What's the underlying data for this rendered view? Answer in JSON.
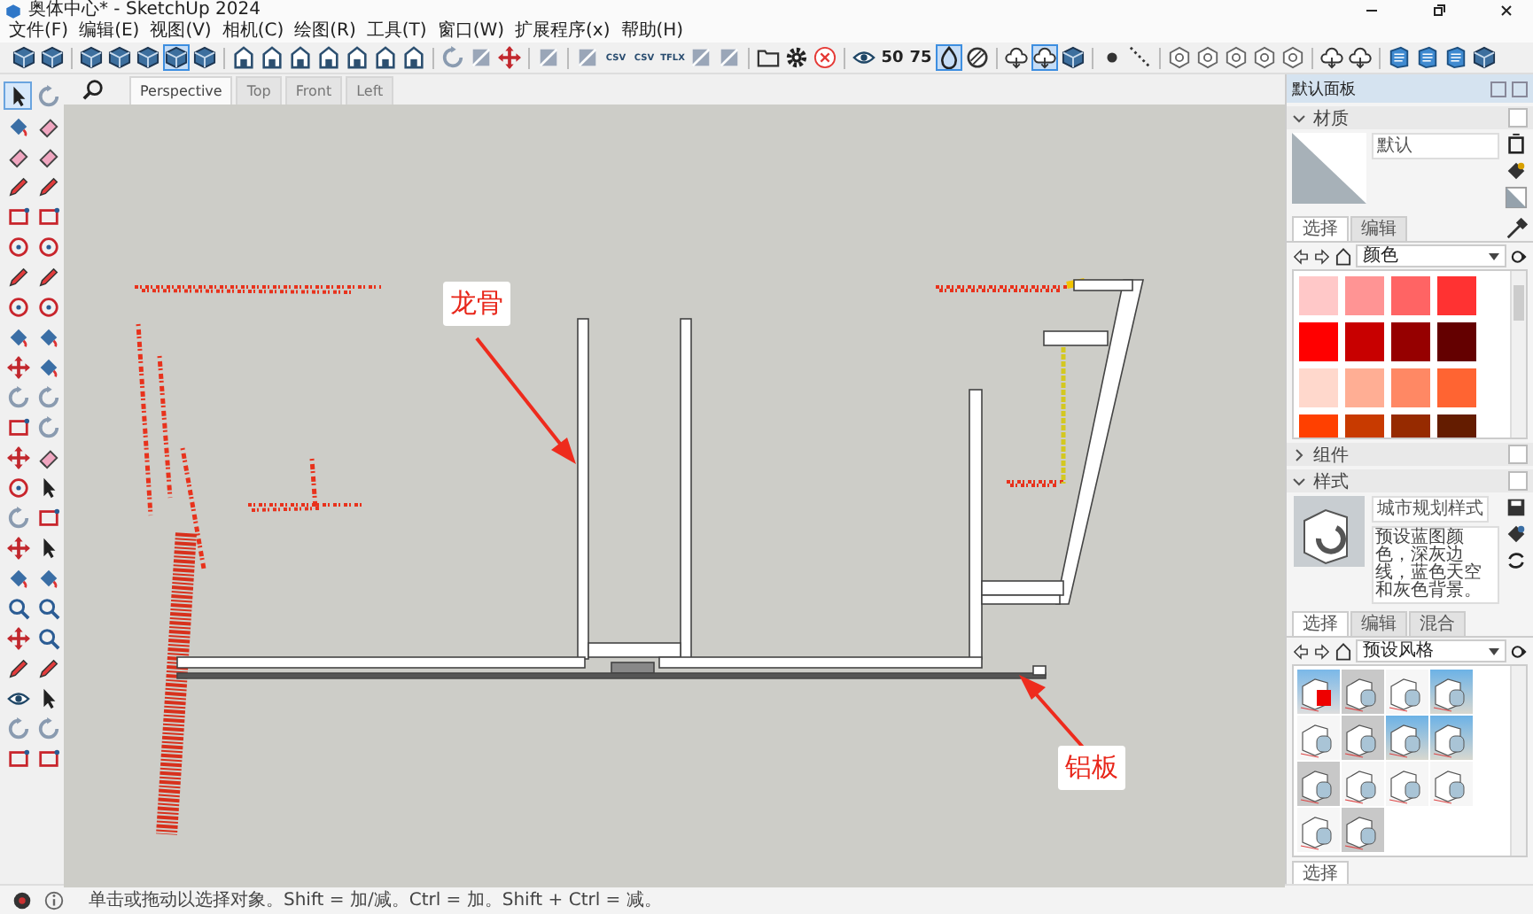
{
  "window": {
    "title": "奥体中心* - SketchUp 2024"
  },
  "menu": [
    "文件(F)",
    "编辑(E)",
    "视图(V)",
    "相机(C)",
    "绘图(R)",
    "工具(T)",
    "窗口(W)",
    "扩展程序(x)",
    "帮助(H)"
  ],
  "toolbar": [
    {
      "kind": "cube",
      "selected": false
    },
    {
      "kind": "cube",
      "selected": false
    },
    {
      "kind": "sep"
    },
    {
      "kind": "cube",
      "selected": false
    },
    {
      "kind": "cube",
      "selected": false
    },
    {
      "kind": "cube",
      "selected": false
    },
    {
      "kind": "cube",
      "selected": true
    },
    {
      "kind": "cube",
      "selected": false
    },
    {
      "kind": "sep"
    },
    {
      "kind": "view",
      "selected": false
    },
    {
      "kind": "view",
      "selected": false
    },
    {
      "kind": "view",
      "selected": false
    },
    {
      "kind": "view",
      "selected": false
    },
    {
      "kind": "view",
      "selected": false
    },
    {
      "kind": "view",
      "selected": false
    },
    {
      "kind": "view",
      "selected": false
    },
    {
      "kind": "sep"
    },
    {
      "kind": "orbit",
      "selected": false
    },
    {
      "kind": "section",
      "selected": false
    },
    {
      "kind": "move",
      "selected": false
    },
    {
      "kind": "sep"
    },
    {
      "kind": "section",
      "selected": false
    },
    {
      "kind": "sep"
    },
    {
      "kind": "section",
      "selected": false
    },
    {
      "kind": "csv",
      "label": "CSV",
      "selected": false
    },
    {
      "kind": "csv",
      "label": "CSV",
      "selected": false
    },
    {
      "kind": "csv",
      "label": "TFLX",
      "selected": false
    },
    {
      "kind": "section",
      "selected": false
    },
    {
      "kind": "section",
      "selected": false
    },
    {
      "kind": "sep"
    },
    {
      "kind": "folder",
      "selected": false
    },
    {
      "kind": "gear",
      "selected": false
    },
    {
      "kind": "close",
      "selected": false
    },
    {
      "kind": "sep"
    },
    {
      "kind": "eye",
      "selected": false
    },
    {
      "kind": "cloud-num",
      "label": "50",
      "selected": false
    },
    {
      "kind": "cloud-num",
      "label": "75",
      "selected": false
    },
    {
      "kind": "drop",
      "selected": true
    },
    {
      "kind": "ball",
      "selected": false
    },
    {
      "kind": "sep"
    },
    {
      "kind": "cloud",
      "selected": false
    },
    {
      "kind": "cloud",
      "selected": true
    },
    {
      "kind": "cube",
      "selected": false
    },
    {
      "kind": "sep"
    },
    {
      "kind": "dot",
      "selected": false
    },
    {
      "kind": "dots",
      "selected": false
    },
    {
      "kind": "sep"
    },
    {
      "kind": "hex",
      "selected": false
    },
    {
      "kind": "hex",
      "selected": false
    },
    {
      "kind": "hex",
      "selected": false
    },
    {
      "kind": "hex",
      "selected": false
    },
    {
      "kind": "hex",
      "selected": false
    },
    {
      "kind": "sep"
    },
    {
      "kind": "cloud",
      "selected": false
    },
    {
      "kind": "cloud",
      "selected": false
    },
    {
      "kind": "sep"
    },
    {
      "kind": "book",
      "selected": false
    },
    {
      "kind": "book",
      "selected": false
    },
    {
      "kind": "book",
      "selected": false
    },
    {
      "kind": "cube",
      "selected": false
    }
  ],
  "left_tools": [
    {
      "kind": "arrow",
      "selected": true
    },
    {
      "kind": "orbit",
      "selected": false
    },
    {
      "kind": "paint",
      "selected": false
    },
    {
      "kind": "eraser",
      "selected": false
    },
    {
      "kind": "eraser",
      "selected": false
    },
    {
      "kind": "eraser",
      "selected": false
    },
    {
      "kind": "pencil",
      "selected": false
    },
    {
      "kind": "pencil",
      "selected": false
    },
    {
      "kind": "rect",
      "selected": false
    },
    {
      "kind": "rect",
      "selected": false
    },
    {
      "kind": "circle",
      "selected": false
    },
    {
      "kind": "circle",
      "selected": false
    },
    {
      "kind": "pencil",
      "selected": false
    },
    {
      "kind": "pencil",
      "selected": false
    },
    {
      "kind": "circle",
      "selected": false
    },
    {
      "kind": "circle",
      "selected": false
    },
    {
      "kind": "paint",
      "selected": false
    },
    {
      "kind": "paint",
      "selected": false
    },
    {
      "kind": "move",
      "selected": false
    },
    {
      "kind": "paint",
      "selected": false
    },
    {
      "kind": "orbit",
      "selected": false
    },
    {
      "kind": "orbit",
      "selected": false
    },
    {
      "kind": "rect",
      "selected": false
    },
    {
      "kind": "orbit",
      "selected": false
    },
    {
      "kind": "move",
      "selected": false
    },
    {
      "kind": "eraser",
      "selected": false
    },
    {
      "kind": "circle",
      "selected": false
    },
    {
      "kind": "arrow",
      "selected": false
    },
    {
      "kind": "orbit",
      "selected": false
    },
    {
      "kind": "rect",
      "selected": false
    },
    {
      "kind": "move",
      "selected": false
    },
    {
      "kind": "arrow",
      "selected": false
    },
    {
      "kind": "paint",
      "selected": false
    },
    {
      "kind": "paint",
      "selected": false
    },
    {
      "kind": "zoom",
      "selected": false
    },
    {
      "kind": "zoom",
      "selected": false
    },
    {
      "kind": "move",
      "selected": false
    },
    {
      "kind": "zoom",
      "selected": false
    },
    {
      "kind": "pencil",
      "selected": false
    },
    {
      "kind": "pencil",
      "selected": false
    },
    {
      "kind": "eye",
      "selected": false
    },
    {
      "kind": "arrow",
      "selected": false
    },
    {
      "kind": "orbit",
      "selected": false
    },
    {
      "kind": "orbit",
      "selected": false
    },
    {
      "kind": "rect",
      "selected": false
    },
    {
      "kind": "rect",
      "selected": false
    }
  ],
  "scene_tabs": [
    {
      "label": "Perspective",
      "selected": true
    },
    {
      "label": "Top",
      "selected": false
    },
    {
      "label": "Front",
      "selected": false
    },
    {
      "label": "Left",
      "selected": false
    }
  ],
  "annotations": [
    {
      "kind": "stud",
      "label": "龙骨"
    },
    {
      "kind": "plate",
      "label": "铝板"
    }
  ],
  "panel": {
    "title": "默认面板",
    "materials": {
      "title": "材质",
      "expanded": true,
      "name": "默认",
      "tabs": [
        {
          "label": "选择",
          "selected": true
        },
        {
          "label": "编辑",
          "selected": false
        }
      ],
      "library": "颜色",
      "swatches": [
        {
          "color": "#ffc8c8"
        },
        {
          "color": "#ff9494"
        },
        {
          "color": "#ff6464"
        },
        {
          "color": "#ff3232"
        },
        {
          "color": "#ff0000"
        },
        {
          "color": "#c80000"
        },
        {
          "color": "#960000"
        },
        {
          "color": "#640000"
        },
        {
          "color": "#ffd8cc"
        },
        {
          "color": "#ffae94"
        },
        {
          "color": "#ff8864"
        },
        {
          "color": "#ff6432"
        },
        {
          "color": "#ff4000"
        },
        {
          "color": "#c83a00"
        },
        {
          "color": "#962a00"
        },
        {
          "color": "#641c00"
        }
      ]
    },
    "components": {
      "title": "组件",
      "expanded": false
    },
    "styles": {
      "title": "样式",
      "expanded": true,
      "name": "城市规划样式",
      "description": "预设蓝图颜色，深灰边线，蓝色天空和灰色背景。",
      "tabs": [
        {
          "label": "选择",
          "selected": true
        },
        {
          "label": "编辑",
          "selected": false
        },
        {
          "label": "混合",
          "selected": false
        }
      ],
      "library": "预设风格",
      "thumbnails": [
        {
          "kind": "red"
        },
        {
          "kind": "grey"
        },
        {
          "kind": "white"
        },
        {
          "kind": "sky"
        },
        {
          "kind": "white"
        },
        {
          "kind": "grey"
        },
        {
          "kind": "sky"
        },
        {
          "kind": "sky"
        },
        {
          "kind": "grey"
        },
        {
          "kind": "white"
        },
        {
          "kind": "white"
        },
        {
          "kind": "white"
        },
        {
          "kind": "white"
        },
        {
          "kind": "grey"
        }
      ]
    },
    "bottom_tab": "选择"
  },
  "status_bar": {
    "message": "单击或拖动以选择对象。Shift = 加/减。Ctrl = 加。Shift + Ctrl = 减。"
  }
}
